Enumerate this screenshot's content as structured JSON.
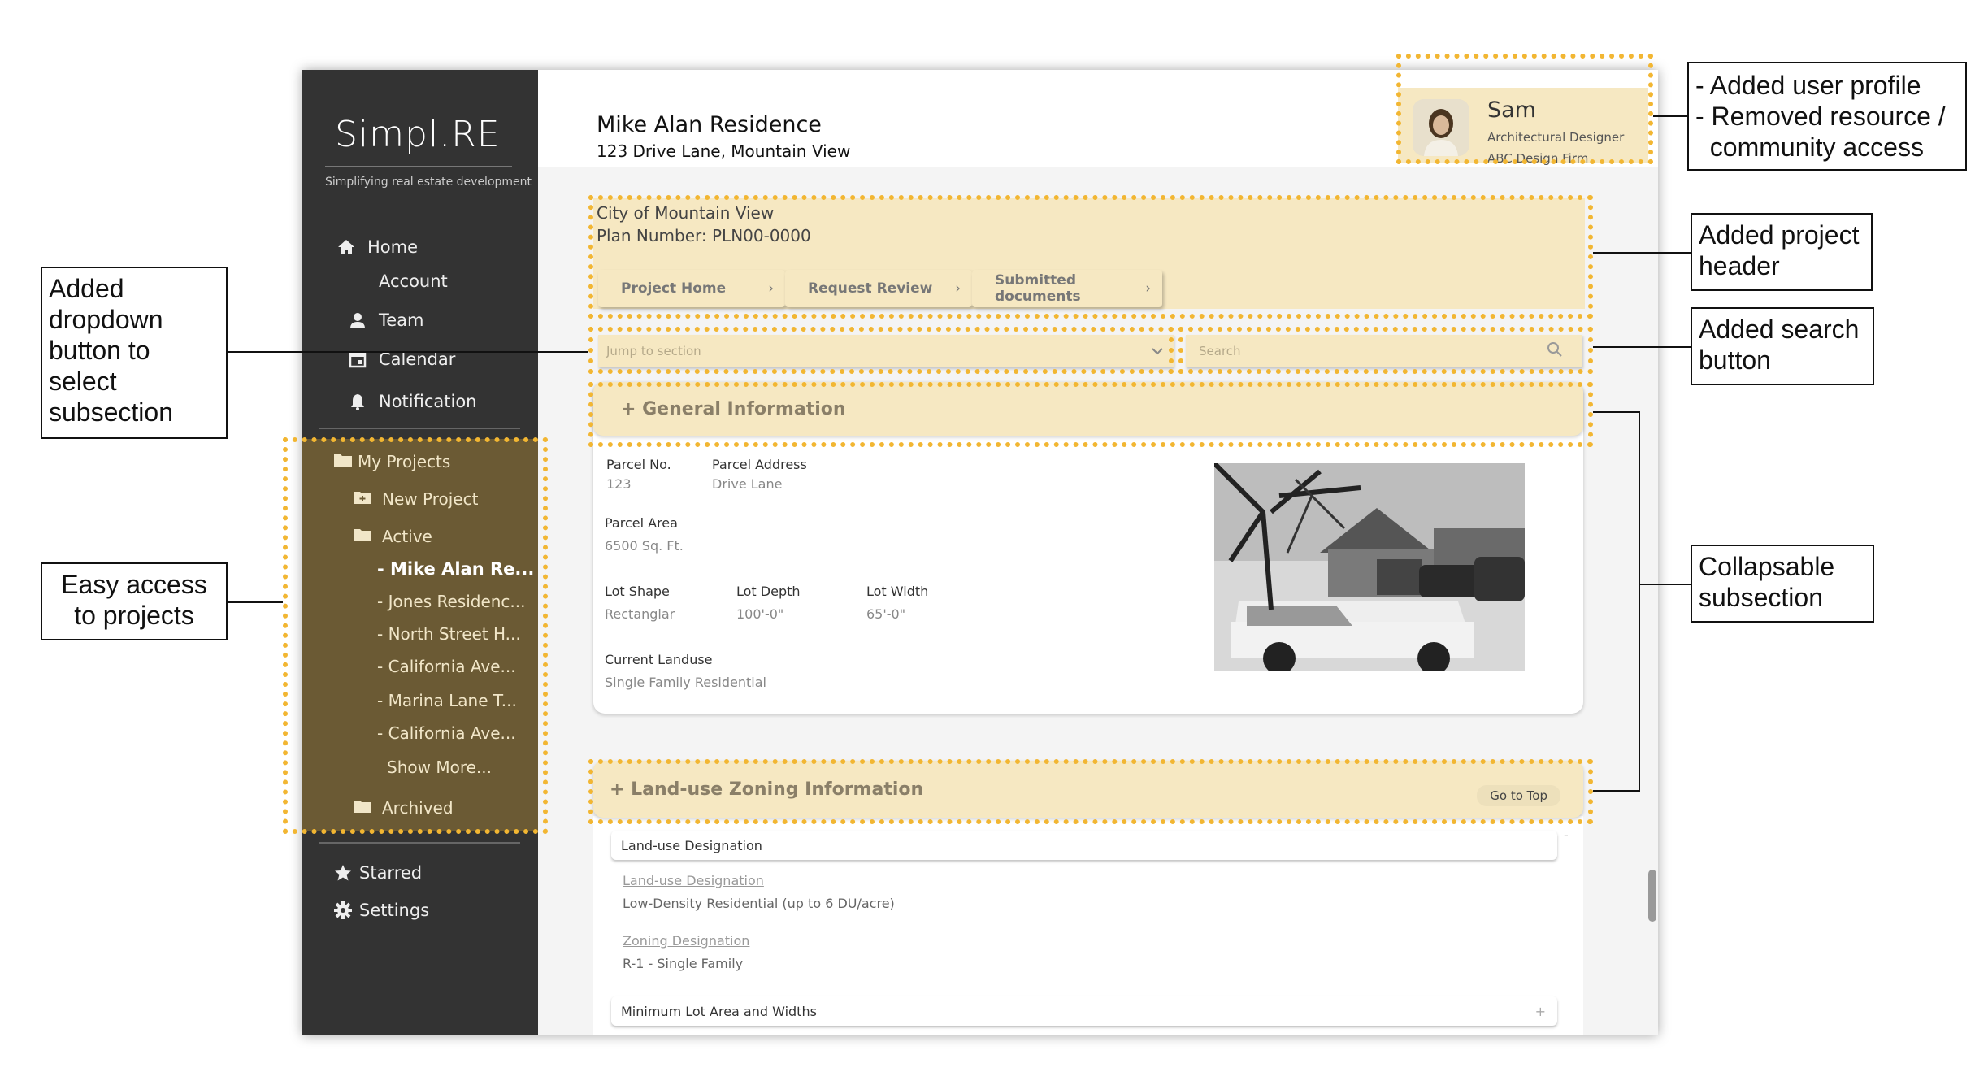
{
  "sidebar": {
    "logo": "Simpl.RE",
    "tagline": "Simplifying real estate development",
    "nav": {
      "home": "Home",
      "account": "Account",
      "team": "Team",
      "calendar": "Calendar",
      "notification": "Notification"
    },
    "projects": {
      "my_projects": "My Projects",
      "new_project": "New Project",
      "active": "Active",
      "items": [
        "- Mike Alan Re...",
        "- Jones Residenc...",
        "- North Street H...",
        "- California Ave...",
        "- Marina Lane T...",
        "- California Ave..."
      ],
      "show_more": "Show More...",
      "archived": "Archived"
    },
    "starred": "Starred",
    "settings": "Settings"
  },
  "topbar": {
    "title": "Mike Alan Residence",
    "address": "123 Drive Lane, Mountain View"
  },
  "profile": {
    "name": "Sam",
    "role": "Architectural Designer",
    "firm": "ABC Design Firm"
  },
  "project_header": {
    "city": "City of Mountain View",
    "plan": "Plan Number: PLN00-0000",
    "buttons": [
      "Project Home",
      "Request Review",
      "Submitted documents"
    ]
  },
  "jump": {
    "placeholder": "Jump to section"
  },
  "search": {
    "placeholder": "Search"
  },
  "general": {
    "title": "+ General Information",
    "fields": {
      "parcel_no_label": "Parcel No.",
      "parcel_no_value": "123",
      "parcel_address_label": "Parcel Address",
      "parcel_address_value": "Drive Lane",
      "parcel_area_label": "Parcel Area",
      "parcel_area_value": "6500 Sq. Ft.",
      "lot_shape_label": "Lot Shape",
      "lot_shape_value": "Rectanglar",
      "lot_depth_label": "Lot Depth",
      "lot_depth_value": "100'-0\"",
      "lot_width_label": "Lot Width",
      "lot_width_value": "65'-0\"",
      "landuse_label": "Current Landuse",
      "landuse_value": "Single Family Residential"
    }
  },
  "zoning": {
    "title": "+ Land-use Zoning Information",
    "go_top": "Go to Top",
    "sub1": "Land-use Designation",
    "sub1_collapse": "-",
    "landuse_link": "Land-use Designation",
    "landuse_value": "Low-Density Residential (up to 6 DU/acre)",
    "zoning_link": "Zoning Designation",
    "zoning_value": "R-1 - Single Family",
    "sub2": "Minimum Lot Area and Widths",
    "sub2_expand": "+"
  },
  "annotations": {
    "profile_line1": "- Added user profile",
    "profile_line2": "- Removed resource /",
    "profile_line3": "  community access",
    "header": "Added project header",
    "dropdown": "Added dropdown button to select subsection",
    "search": "Added search button",
    "collapse": "Collapsable subsection",
    "projects": "Easy access to projects"
  },
  "colors": {
    "sidebar": "#333333",
    "projects_bg": "#6b5a34",
    "highlight": "#f6e8c2",
    "dotted": "#f2b632"
  }
}
